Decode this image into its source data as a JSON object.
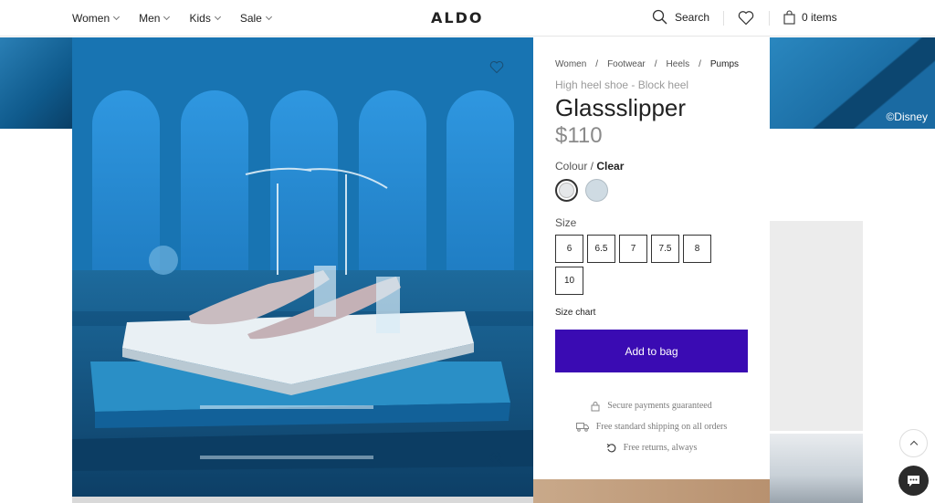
{
  "header": {
    "nav": [
      {
        "label": "Women"
      },
      {
        "label": "Men"
      },
      {
        "label": "Kids"
      },
      {
        "label": "Sale"
      }
    ],
    "logo": "ALDO",
    "search_label": "Search",
    "bag_label": "0 items"
  },
  "gallery": {
    "watermark": "©Disney"
  },
  "product": {
    "breadcrumbs": [
      "Women",
      "/",
      "Footwear",
      "/",
      "Heels",
      "/",
      "Pumps"
    ],
    "subtitle": "High heel shoe - Block heel",
    "name": "Glassslipper",
    "price": "$110",
    "colour_label": "Colour /",
    "colour_value": "Clear",
    "colours": [
      {
        "hex": "#e5e7e9",
        "selected": true
      },
      {
        "hex": "#cfdbe3",
        "selected": false
      }
    ],
    "size_label": "Size",
    "sizes": [
      "6",
      "6.5",
      "7",
      "7.5",
      "8",
      "10"
    ],
    "size_chart_label": "Size chart",
    "add_to_bag": "Add to bag",
    "perks": [
      {
        "icon": "lock-icon",
        "text": "Secure payments guaranteed"
      },
      {
        "icon": "truck-icon",
        "text": "Free standard shipping on all orders"
      },
      {
        "icon": "return-icon",
        "text": "Free returns, always"
      }
    ]
  },
  "colors": {
    "accent": "#3a0bb3",
    "hero_blue": "#1b6ea9"
  }
}
